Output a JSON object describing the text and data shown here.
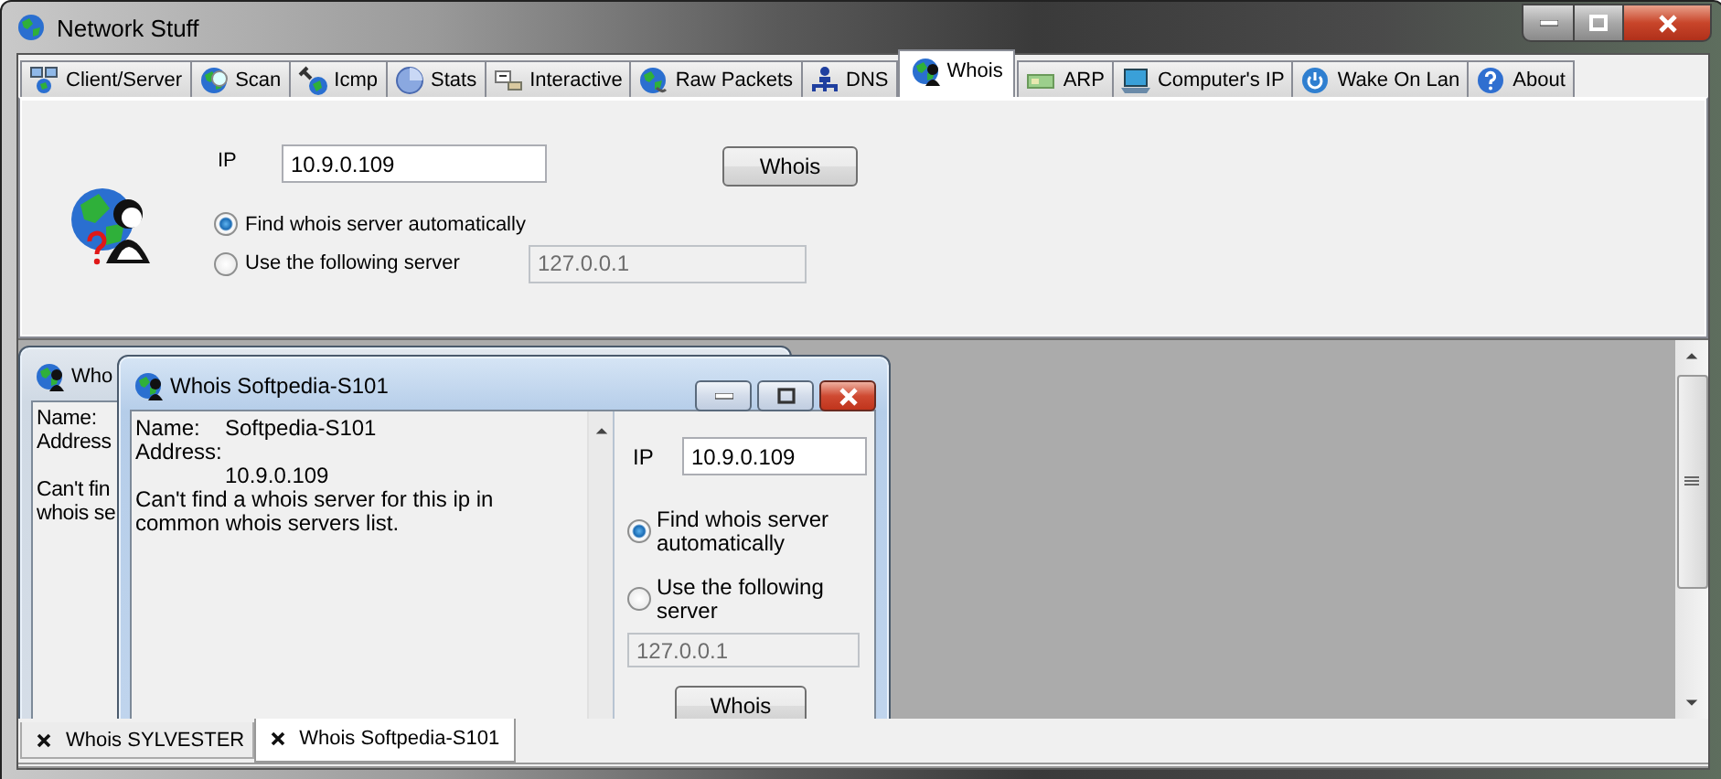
{
  "window": {
    "title": "Network Stuff"
  },
  "tabs": [
    {
      "label": "Client/Server",
      "selected": false
    },
    {
      "label": "Scan",
      "selected": false
    },
    {
      "label": "Icmp",
      "selected": false
    },
    {
      "label": "Stats",
      "selected": false
    },
    {
      "label": "Interactive",
      "selected": false
    },
    {
      "label": "Raw Packets",
      "selected": false
    },
    {
      "label": "DNS",
      "selected": false
    },
    {
      "label": "Whois",
      "selected": true
    },
    {
      "label": "ARP",
      "selected": false
    },
    {
      "label": "Computer's IP",
      "selected": false
    },
    {
      "label": "Wake On Lan",
      "selected": false
    },
    {
      "label": "About",
      "selected": false
    }
  ],
  "whois_tab": {
    "ip_label": "IP",
    "ip": "10.9.0.109",
    "button": "Whois",
    "server_options": [
      {
        "label": "Find whois server automatically",
        "selected": true
      },
      {
        "label": "Use the following server",
        "selected": false
      }
    ],
    "server": "127.0.0.1",
    "server_disabled": true
  },
  "documents": [
    {
      "title": "Who",
      "active": false,
      "output": {
        "name_label": "Name:",
        "address_label": "Address",
        "message_lines": [
          "Can't fin",
          "whois se"
        ]
      }
    },
    {
      "title": "Whois Softpedia-S101",
      "active": true,
      "output": {
        "name_label": "Name:",
        "name": "Softpedia-S101",
        "address_label": "Address:",
        "address": "10.9.0.109",
        "message": "Can't find a whois server for this ip in common whois servers list."
      },
      "form": {
        "ip_label": "IP",
        "ip": "10.9.0.109",
        "server_options": [
          {
            "label": "Find whois server automatically",
            "selected": true
          },
          {
            "label": "Use the following server",
            "selected": false
          }
        ],
        "server": "127.0.0.1",
        "server_disabled": true,
        "button": "Whois"
      }
    }
  ],
  "document_tabs": [
    {
      "label": "Whois SYLVESTER",
      "selected": false
    },
    {
      "label": "Whois Softpedia-S101",
      "selected": true
    }
  ]
}
